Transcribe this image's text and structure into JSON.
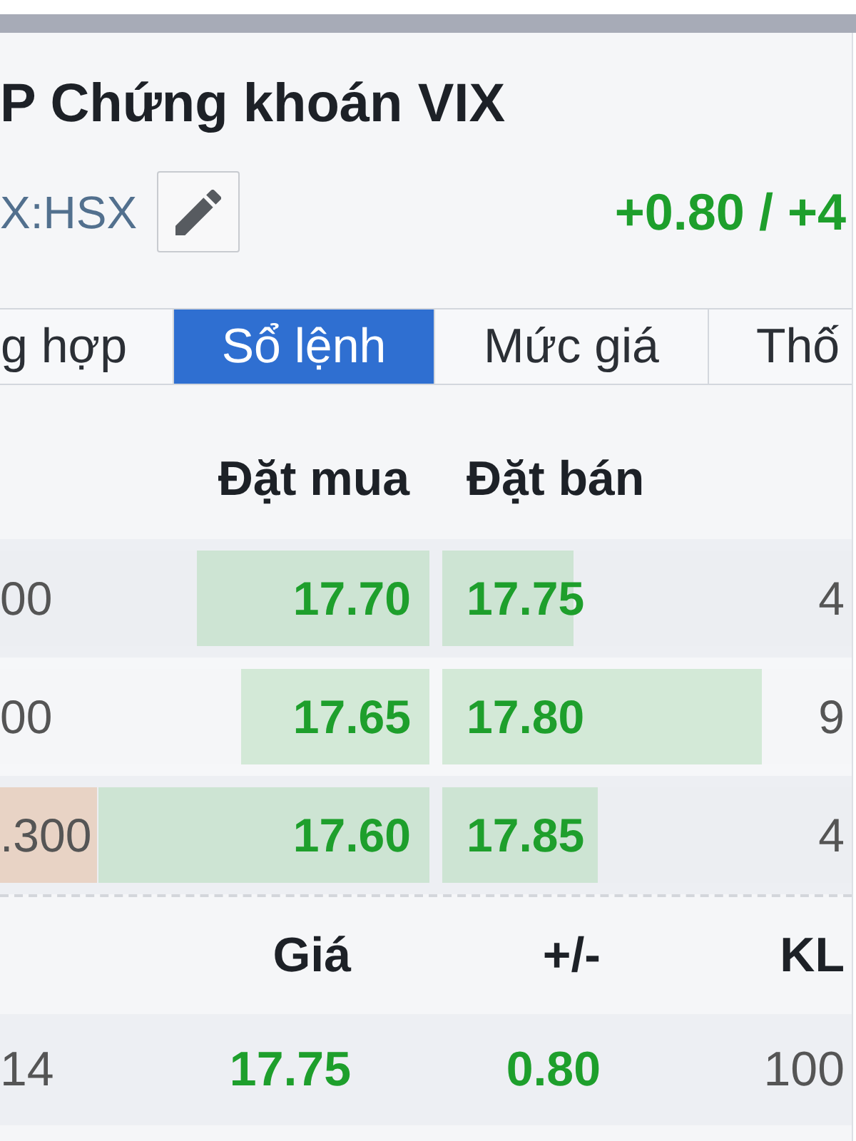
{
  "header": {
    "title": "P Chứng khoán VIX",
    "exchange": "X:HSX",
    "change": "+0.80 / +4",
    "rising": true
  },
  "tabs": [
    {
      "label": "g hợp",
      "selected": false
    },
    {
      "label": "Sổ lệnh",
      "selected": true
    },
    {
      "label": "Mức giá",
      "selected": false
    },
    {
      "label": "Thố",
      "selected": false
    }
  ],
  "order_book": {
    "columns": [
      "Đặt mua",
      "Đặt bán"
    ],
    "rows": [
      {
        "bid_volume": "00",
        "bid_volume_highlighted": false,
        "bid": {
          "price": "17.70",
          "rising": true,
          "level": 0.54
        },
        "ask": {
          "price": "17.75",
          "rising": true,
          "level": 0.32
        },
        "ask_volume": "4"
      },
      {
        "bid_volume": "00",
        "bid_volume_highlighted": false,
        "bid": {
          "price": "17.65",
          "rising": true,
          "level": 0.44
        },
        "ask": {
          "price": "17.80",
          "rising": true,
          "level": 0.78
        },
        "ask_volume": "9"
      },
      {
        "bid_volume": ".300",
        "bid_volume_highlighted": true,
        "bid": {
          "price": "17.60",
          "rising": true,
          "level": 0.77
        },
        "ask": {
          "price": "17.85",
          "rising": true,
          "level": 0.38
        },
        "ask_volume": "4"
      }
    ]
  },
  "trades": {
    "columns": [
      "Giá",
      "+/-",
      "KL"
    ],
    "rows": [
      {
        "time": "14",
        "price": "17.75",
        "change": "0.80",
        "rising": true,
        "volume": "100"
      }
    ]
  }
}
